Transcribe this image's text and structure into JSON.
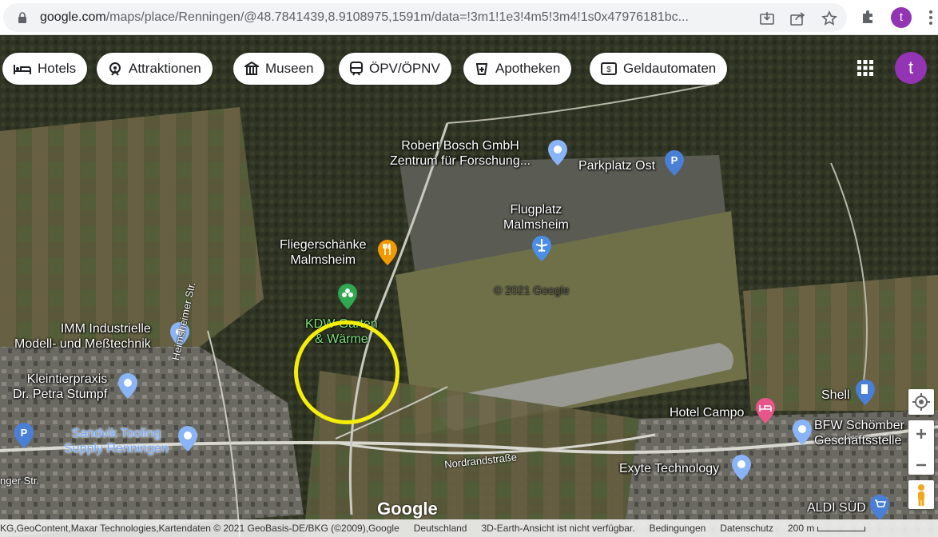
{
  "browser": {
    "url_host": "google.com",
    "url_path": "/maps/place/Renningen/@48.7841439,8.9108975,1591m/data=!3m1!1e3!4m5!3m4!1s0x47976181bc...",
    "profile_initial": "t"
  },
  "chips": [
    {
      "label": "Hotels",
      "icon": "bed-icon"
    },
    {
      "label": "Attraktionen",
      "icon": "attraction-icon"
    },
    {
      "label": "Museen",
      "icon": "museum-icon"
    },
    {
      "label": "ÖPV/ÖPNV",
      "icon": "transit-icon"
    },
    {
      "label": "Apotheken",
      "icon": "pharmacy-icon"
    },
    {
      "label": "Geldautomaten",
      "icon": "atm-icon"
    }
  ],
  "account_initial": "t",
  "places": {
    "bosch_1": "Robert Bosch GmbH",
    "bosch_2": "Zentrum für Forschung...",
    "parkplatz": "Parkplatz Ost",
    "flugplatz_1": "Flugplatz",
    "flugplatz_2": "Malmsheim",
    "fliegerschaenke_1": "Fliegerschänke",
    "fliegerschaenke_2": "Malmsheim",
    "kdw_1": "KDW Garten",
    "kdw_2": "& Wärme",
    "imm_1": "IMM Industrielle",
    "imm_2": "Modell- und Meßtechnik",
    "kleintier_1": "Kleintierpraxis",
    "kleintier_2": "Dr. Petra Stumpf",
    "sandvik_1": "Sandvik Tooling",
    "sandvik_2": "Supply Renningen",
    "shell": "Shell",
    "hotel_campo": "Hotel Campo",
    "bfw_1": "BFW Schömber",
    "bfw_2": "Geschäftsstelle",
    "exyte": "Exyte Technology",
    "aldi": "ALDI SÜD",
    "watermark": "© 2021 Google"
  },
  "roads": {
    "heimsheimer": "Heimsheimer Str.",
    "nordrand": "Nordrandstraße",
    "anger": "nger Str."
  },
  "logo": "Google",
  "footer": {
    "attribution": "KG,GeoContent,Maxar Technologies,Kartendaten © 2021 GeoBasis-DE/BKG (©2009),Google",
    "country": "Deutschland",
    "earth_note": "3D-Earth-Ansicht ist nicht verfügbar.",
    "terms": "Bedingungen",
    "privacy": "Datenschutz",
    "scale": "200 m"
  },
  "colors": {
    "highlight_circle": "#f5ee0b",
    "avatar": "#9334b4",
    "pin_gray": "#8ab4f8",
    "pin_food": "#f29900",
    "pin_hotel": "#e8558a",
    "pin_park": "#4a7fd8",
    "pin_airport": "#4a8ee8"
  }
}
